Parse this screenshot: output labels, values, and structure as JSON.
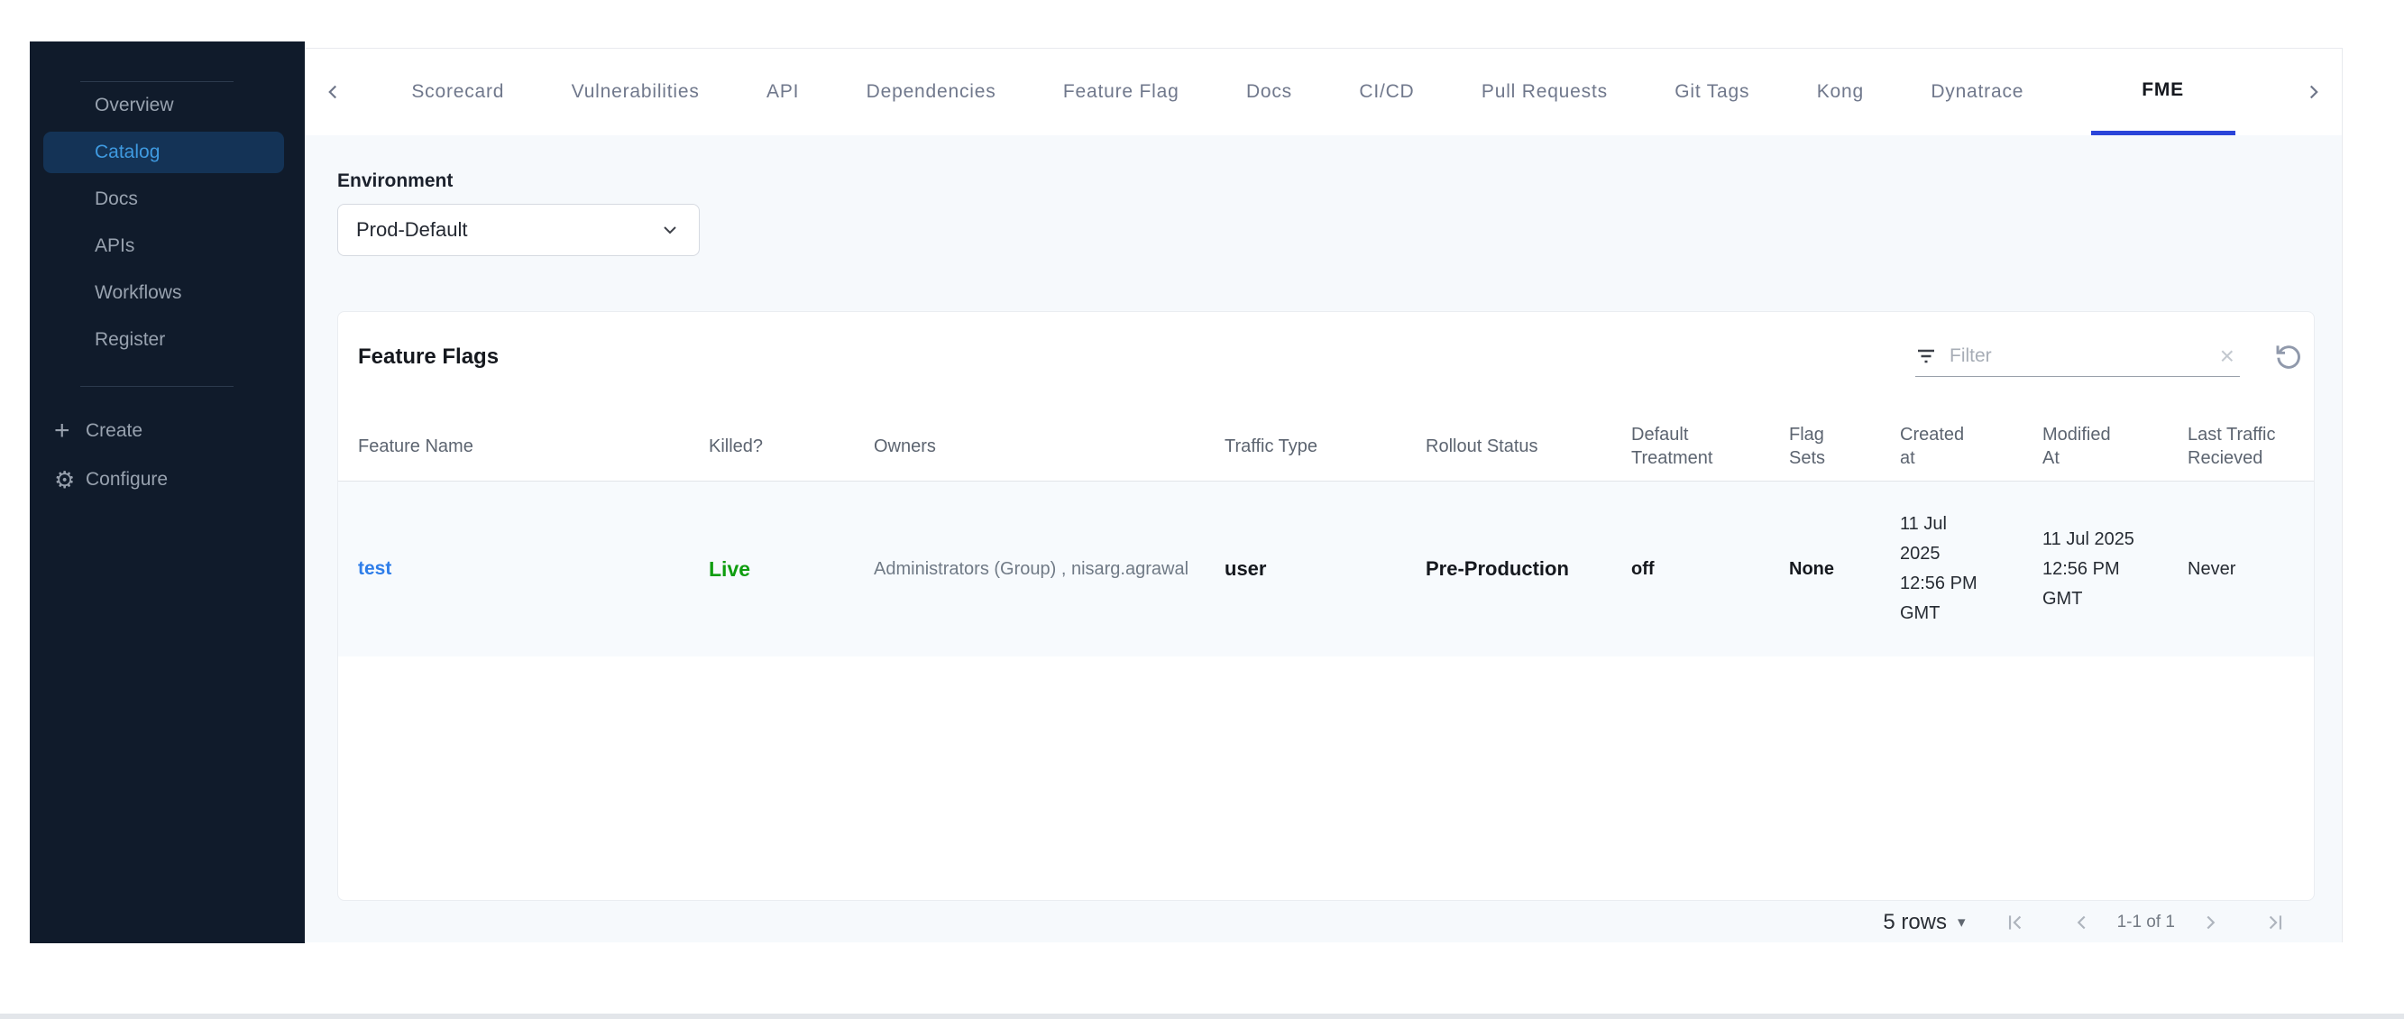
{
  "sidebar": {
    "items": [
      {
        "label": "Overview"
      },
      {
        "label": "Catalog"
      },
      {
        "label": "Docs"
      },
      {
        "label": "APIs"
      },
      {
        "label": "Workflows"
      },
      {
        "label": "Register"
      }
    ],
    "active_item": "Catalog",
    "create_label": "Create",
    "configure_label": "Configure"
  },
  "tabs": {
    "items": [
      {
        "label": "Scorecard"
      },
      {
        "label": "Vulnerabilities"
      },
      {
        "label": "API"
      },
      {
        "label": "Dependencies"
      },
      {
        "label": "Feature Flag"
      },
      {
        "label": "Docs"
      },
      {
        "label": "CI/CD"
      },
      {
        "label": "Pull Requests"
      },
      {
        "label": "Git Tags"
      },
      {
        "label": "Kong"
      },
      {
        "label": "Dynatrace"
      },
      {
        "label": "FME"
      }
    ],
    "active_tab": "FME"
  },
  "environment": {
    "label": "Environment",
    "selected_option": "Prod-Default"
  },
  "feature_flags": {
    "title": "Feature Flags",
    "filter_placeholder": "Filter",
    "columns": [
      "Feature Name",
      "Killed?",
      "Owners",
      "Traffic Type",
      "Rollout Status",
      "Default Treatment",
      "Flag Sets",
      "Created at",
      "Modified At",
      "Last Traffic Recieved"
    ],
    "rows": [
      {
        "feature_name": "test",
        "killed": "Live",
        "owners": "Administrators (Group) , nisarg.agrawal",
        "traffic_type": "user",
        "rollout_status": "Pre-Production",
        "default_treatment": "off",
        "flag_sets": "None",
        "created_at": "11 Jul 2025 12:56 PM GMT",
        "modified_at": "11 Jul 2025 12:56 PM GMT",
        "last_traffic_recieved": "Never"
      }
    ]
  },
  "pagination": {
    "rows_per_page": "5 rows",
    "range_label": "1-1 of 1"
  },
  "colors": {
    "accent": "#2b45d9",
    "link": "#2e7de9",
    "live-green": "#0f9d0f",
    "sidebar-bg": "#101b2b",
    "sidebar-active-bg": "#143356",
    "sidebar-active-text": "#3f9ae0",
    "content-bg": "#f6f9fc",
    "row-bg": "#f7fafd"
  }
}
